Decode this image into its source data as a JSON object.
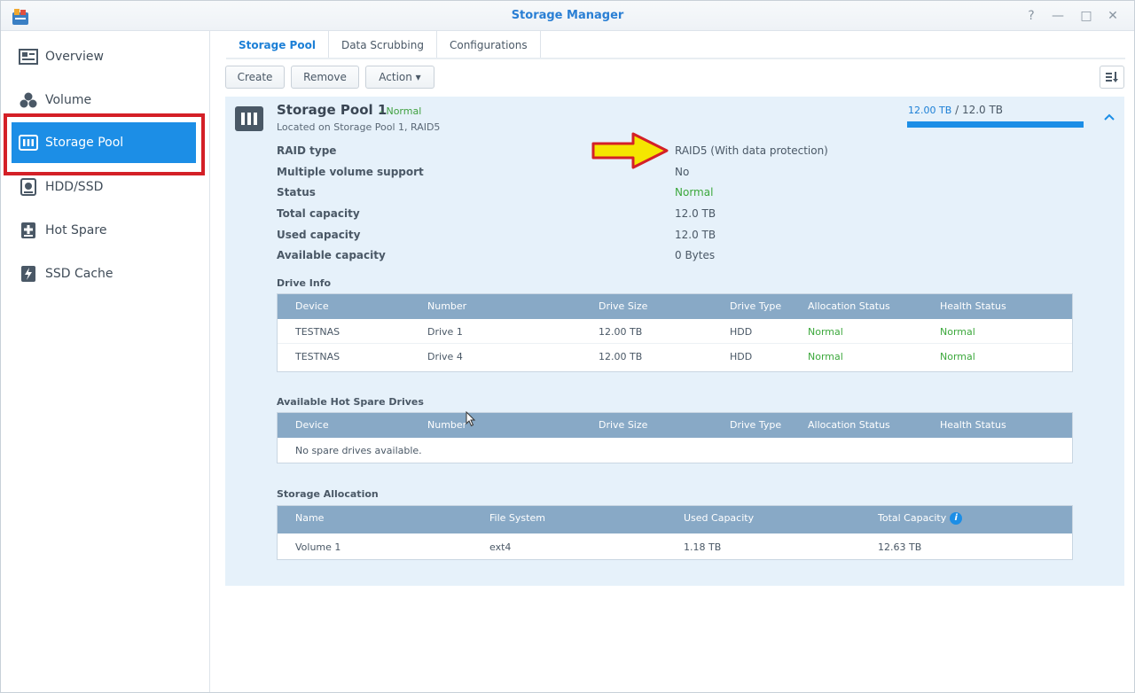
{
  "window": {
    "title": "Storage Manager",
    "help": "?",
    "minimize": "—",
    "maximize": "□",
    "close": "✕"
  },
  "sidebar": {
    "items": [
      {
        "label": "Overview",
        "icon": "overview-icon"
      },
      {
        "label": "Volume",
        "icon": "volume-icon"
      },
      {
        "label": "Storage Pool",
        "icon": "storage-pool-icon"
      },
      {
        "label": "HDD/SSD",
        "icon": "hdd-icon"
      },
      {
        "label": "Hot Spare",
        "icon": "hot-spare-icon"
      },
      {
        "label": "SSD Cache",
        "icon": "ssd-cache-icon"
      }
    ],
    "active": "Storage Pool"
  },
  "tabs": [
    "Storage Pool",
    "Data Scrubbing",
    "Configurations"
  ],
  "toolbar": {
    "create": "Create",
    "remove": "Remove",
    "action": "Action ▾"
  },
  "pool": {
    "name": "Storage Pool 1",
    "status": "- Normal",
    "location": "Located on Storage Pool 1, RAID5",
    "capacity_used": "12.00 TB",
    "capacity_total": " / 12.0  TB",
    "usage_fraction": 1.0,
    "properties": [
      {
        "label": "RAID type",
        "value": "RAID5  (With data protection)"
      },
      {
        "label": "Multiple volume support",
        "value": "No"
      },
      {
        "label": "Status",
        "value": "Normal"
      },
      {
        "label": "Total capacity",
        "value": "12.0  TB"
      },
      {
        "label": "Used capacity",
        "value": "12.0  TB"
      },
      {
        "label": "Available capacity",
        "value": "0 Bytes"
      }
    ]
  },
  "drive_info": {
    "title": "Drive Info",
    "headers": [
      "Device",
      "Number",
      "Drive Size",
      "Drive Type",
      "Allocation Status",
      "Health Status"
    ],
    "rows": [
      [
        "TESTNAS",
        "Drive 1",
        "12.00 TB",
        "HDD",
        "Normal",
        "Normal"
      ],
      [
        "TESTNAS",
        "Drive 4",
        "12.00 TB",
        "HDD",
        "Normal",
        "Normal"
      ]
    ]
  },
  "hot_spare": {
    "title": "Available Hot Spare Drives",
    "headers": [
      "Device",
      "Number",
      "Drive Size",
      "Drive Type",
      "Allocation Status",
      "Health Status"
    ],
    "empty": "No spare drives available."
  },
  "allocation": {
    "title": "Storage Allocation",
    "headers": [
      "Name",
      "File System",
      "Used Capacity",
      "Total Capacity"
    ],
    "rows": [
      [
        "Volume 1",
        "ext4",
        "1.18 TB",
        "12.63 TB"
      ]
    ]
  },
  "colors": {
    "accent": "#1c8ee6",
    "highlight": "#d42027",
    "arrow": "#f5e600"
  }
}
